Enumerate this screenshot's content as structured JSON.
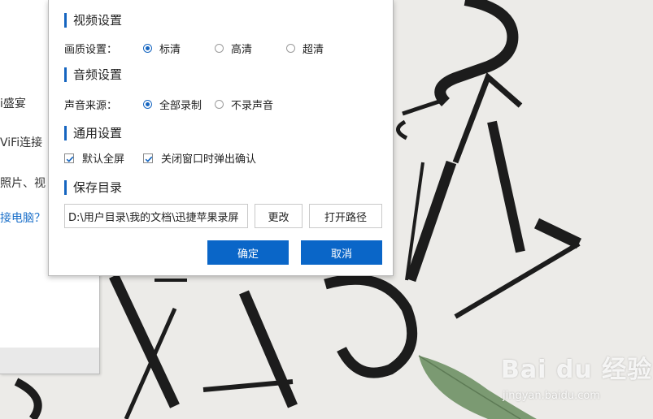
{
  "background": {
    "under_window_lines": [
      "i盛宴",
      "ViFi连接",
      "照片、视",
      "接电脑？"
    ],
    "watermark": {
      "logo": "Bai du 经验",
      "url": "jingyan.baidu.com"
    }
  },
  "dialog": {
    "video": {
      "title": "视频设置",
      "quality_label": "画质设置：",
      "options": [
        {
          "label": "标清",
          "checked": true
        },
        {
          "label": "高清",
          "checked": false
        },
        {
          "label": "超清",
          "checked": false
        }
      ]
    },
    "audio": {
      "title": "音频设置",
      "source_label": "声音来源：",
      "options": [
        {
          "label": "全部录制",
          "checked": true
        },
        {
          "label": "不录声音",
          "checked": false
        }
      ]
    },
    "general": {
      "title": "通用设置",
      "options": [
        {
          "label": "默认全屏",
          "checked": true
        },
        {
          "label": "关闭窗口时弹出确认",
          "checked": true
        }
      ]
    },
    "save": {
      "title": "保存目录",
      "path_value": "D:\\用户目录\\我的文档\\迅捷苹果录屏",
      "change_label": "更改",
      "open_label": "打开路径"
    },
    "ok_label": "确定",
    "cancel_label": "取消"
  },
  "colors": {
    "accent": "#1565c0",
    "primary_button": "#0a66c8",
    "link": "#1a6fc9"
  }
}
